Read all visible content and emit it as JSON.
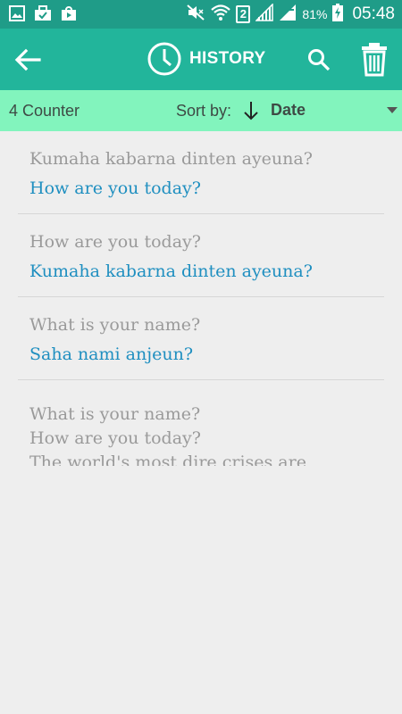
{
  "status_bar": {
    "battery_percent": "81%",
    "sim_slot": "2",
    "time": "05:48",
    "icons": [
      "gallery-icon",
      "briefcase-icon",
      "play-store-icon",
      "mute-icon",
      "wifi-icon",
      "signal-icon",
      "signal-icon",
      "battery-charging-icon"
    ]
  },
  "app_bar": {
    "title": "HISTORY",
    "icons": [
      "back-arrow-icon",
      "clock-icon",
      "search-icon",
      "trash-icon"
    ],
    "color": "#22b59b"
  },
  "sort_bar": {
    "counter": "4 Counter",
    "sort_label": "Sort by:",
    "sort_value": "Date",
    "color": "#82f4bd"
  },
  "history": [
    {
      "source": "Kumaha kabarna dinten ayeuna?",
      "translation": "How are you today?"
    },
    {
      "source": "How are you today?",
      "translation": "Kumaha kabarna dinten ayeuna?"
    },
    {
      "source": "What is your name?",
      "translation": "Saha nami anjeun?"
    },
    {
      "lines": [
        "What is your name?",
        "How are you today?",
        "The world's most dire crises are"
      ]
    }
  ],
  "colors": {
    "status_bar": "#1f9c88",
    "source_text": "#9a9a9a",
    "translation_text": "#1f8fc0",
    "background": "#eeeeee"
  }
}
